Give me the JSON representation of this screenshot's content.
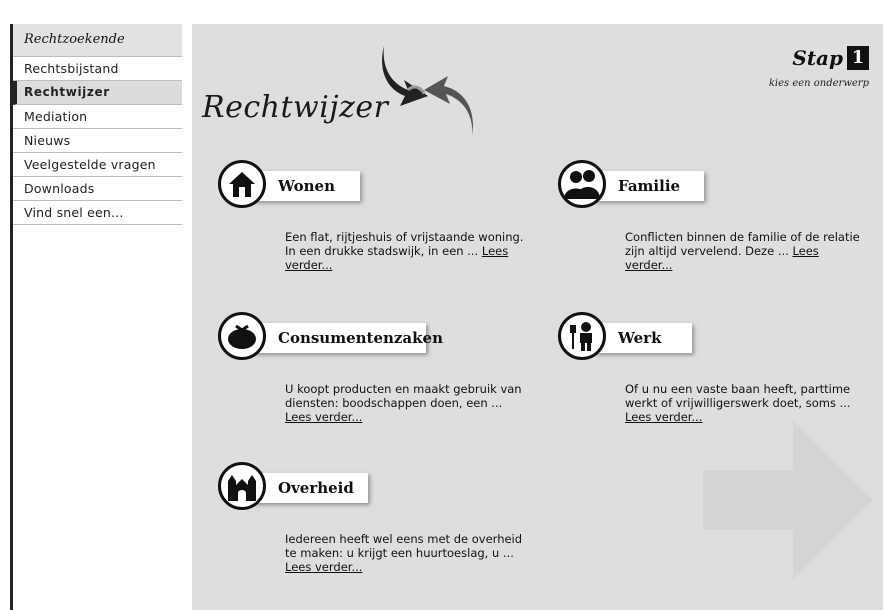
{
  "sidebar": {
    "header": "Rechtzoekende",
    "items": [
      {
        "label": "Rechtsbijstand",
        "active": false
      },
      {
        "label": "Rechtwijzer",
        "active": true
      },
      {
        "label": "Mediation",
        "active": false
      },
      {
        "label": "Nieuws",
        "active": false
      },
      {
        "label": "Veelgestelde vragen",
        "active": false
      },
      {
        "label": "Downloads",
        "active": false
      },
      {
        "label": "Vind snel een...",
        "active": false
      }
    ]
  },
  "main": {
    "title": "Rechtwijzer",
    "step_label": "Stap",
    "step_number": "1",
    "step_subtitle": "kies een onderwerp"
  },
  "topics": [
    {
      "name": "Wonen",
      "icon": "house-icon",
      "text": "Een flat, rijtjeshuis of vrijstaande woning. In een drukke stadswijk, in een ...",
      "link": "Lees verder..."
    },
    {
      "name": "Familie",
      "icon": "family-icon",
      "text": "Conflicten binnen de familie of de relatie zijn altijd vervelend. Deze ...",
      "link": "Lees verder..."
    },
    {
      "name": "Consumentenzaken",
      "icon": "purse-icon",
      "text": "U koopt producten en maakt gebruik van diensten: boodschappen doen, een ...",
      "link": "Lees verder..."
    },
    {
      "name": "Werk",
      "icon": "worker-icon",
      "text": "Of u nu een vaste baan heeft, parttime werkt of vrijwilligerswerk doet, soms ...",
      "link": "Lees verder..."
    },
    {
      "name": "Overheid",
      "icon": "government-building-icon",
      "text": "Iedereen heeft wel eens met de overheid te maken: u krijgt een huurtoeslag, u ...",
      "link": "Lees verder..."
    }
  ]
}
